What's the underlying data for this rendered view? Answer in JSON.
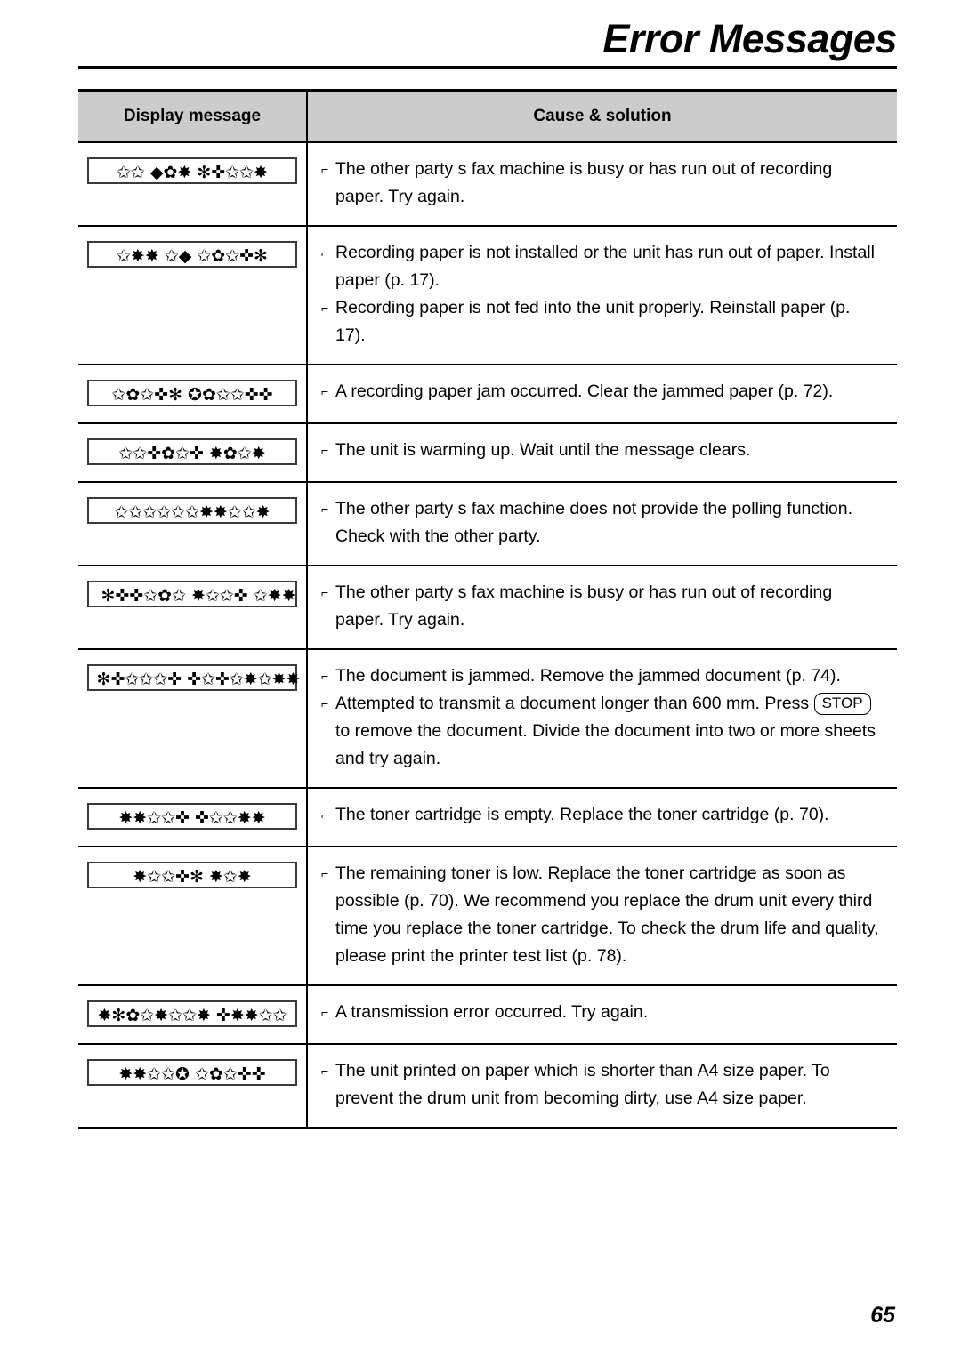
{
  "page": {
    "title": "Error Messages",
    "number": "65"
  },
  "table": {
    "headers": {
      "display_message": "Display message",
      "cause_solution": "Cause & solution"
    },
    "bullet_glyph": "⌐",
    "rows": [
      {
        "display_glyphs": "✩✩ ◆✿✸ ✻✜✩✩✸",
        "items": [
          {
            "text": "The other party s fax machine is busy or has run out of recording paper. Try again."
          }
        ]
      },
      {
        "display_glyphs": "✩✸✸ ✩◆ ✩✿✩✜✻",
        "items": [
          {
            "text": "Recording paper is not installed or the unit has run out of paper. Install paper (p. 17)."
          },
          {
            "text": "Recording paper is not fed into the unit properly. Reinstall paper (p. 17)."
          }
        ]
      },
      {
        "display_glyphs": "✩✿✩✜✻ ✪✿✩✩✜✜",
        "items": [
          {
            "text": "A recording paper jam occurred. Clear the jammed paper (p. 72)."
          }
        ]
      },
      {
        "display_glyphs": "✩✩✜✿✩✜ ✸✿✩✸",
        "items": [
          {
            "text": "The unit is warming up. Wait until the message clears."
          }
        ]
      },
      {
        "display_glyphs": "✩✩✩✩✩✩✸✸✩✩✸",
        "items": [
          {
            "text": "The other party s fax machine does not provide the polling function. Check with the other party."
          }
        ]
      },
      {
        "display_glyphs": "✻✜✜✩✿✩ ✸✩✩✜ ✩✸✸",
        "items": [
          {
            "text": "The other party s fax machine is busy or has run out of recording paper. Try again."
          }
        ]
      },
      {
        "display_glyphs": "✻✜✩✩✩✜ ✜✩✜✩✸✩✸✸",
        "items": [
          {
            "text": "The document is jammed. Remove the jammed document (p. 74)."
          },
          {
            "text_before": "Attempted to transmit a document longer than 600 mm. Press",
            "key": "STOP",
            "text_after": "to remove the document. Divide the document into two or more sheets and try again."
          }
        ]
      },
      {
        "display_glyphs": "✸✸✩✩✜ ✜✩✩✸✸",
        "items": [
          {
            "text": "The toner cartridge is empty. Replace the toner cartridge (p. 70)."
          }
        ]
      },
      {
        "display_glyphs": "✸✩✩✜✻ ✸✩✸",
        "items": [
          {
            "text": "The remaining toner is low. Replace the toner cartridge as soon as possible (p. 70). We recommend you replace the drum unit every third time you replace the toner cartridge. To check the drum life and quality, please print the printer test list (p. 78)."
          }
        ]
      },
      {
        "display_glyphs": "✸✻✿✩✸✩✩✸ ✜✸✸✩✩",
        "items": [
          {
            "text": "A transmission error occurred. Try again."
          }
        ]
      },
      {
        "display_glyphs": "✸✸✩✩✪ ✩✿✩✜✜",
        "items": [
          {
            "text": "The unit printed on paper which is shorter than A4 size paper. To prevent the drum unit from becoming dirty, use A4 size paper."
          }
        ]
      }
    ]
  }
}
